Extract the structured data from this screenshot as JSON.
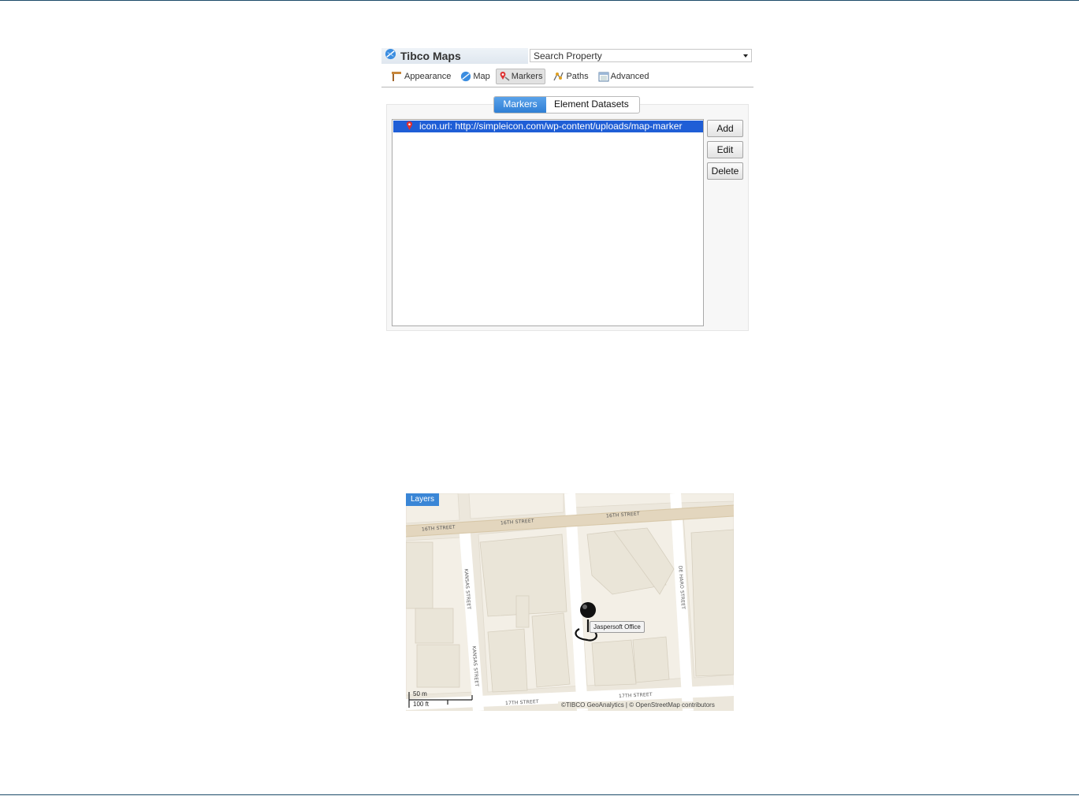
{
  "panel": {
    "title": "Tibco Maps",
    "search_placeholder": "Search Property",
    "toolbar": [
      {
        "label": "Appearance",
        "icon": "appearance-icon"
      },
      {
        "label": "Map",
        "icon": "globe-icon"
      },
      {
        "label": "Markers",
        "icon": "marker-icon"
      },
      {
        "label": "Paths",
        "icon": "paths-icon"
      },
      {
        "label": "Advanced",
        "icon": "advanced-icon"
      }
    ],
    "active_tool": "Markers",
    "tabs": [
      "Markers",
      "Element Datasets"
    ],
    "active_tab": "Markers",
    "list_items": [
      "icon.url: http://simpleicon.com/wp-content/uploads/map-marker"
    ],
    "buttons": {
      "add": "Add",
      "edit": "Edit",
      "delete": "Delete"
    }
  },
  "map": {
    "layers_label": "Layers",
    "streets": {
      "s16a": "16TH STREET",
      "s16b": "16TH STREET",
      "s16c": "16TH STREET",
      "kansas1": "KANSAS STREET",
      "kansas2": "KANSAS STREET",
      "deharo": "DE HARO STREET",
      "s17a": "17TH STREET",
      "s17b": "17TH STREET"
    },
    "marker_label": "Jaspersoft Office",
    "scale_metric": "50 m",
    "scale_imperial": "100 ft",
    "attribution": "©TIBCO GeoAnalytics | © OpenStreetMap contributors"
  },
  "colors": {
    "accent": "#2f7fd5",
    "selection": "#1f5ed6",
    "map_land": "#ece7dc",
    "map_block": "#f3efe6",
    "map_major_road": "#e3d6be",
    "rule": "#1c4a68"
  }
}
